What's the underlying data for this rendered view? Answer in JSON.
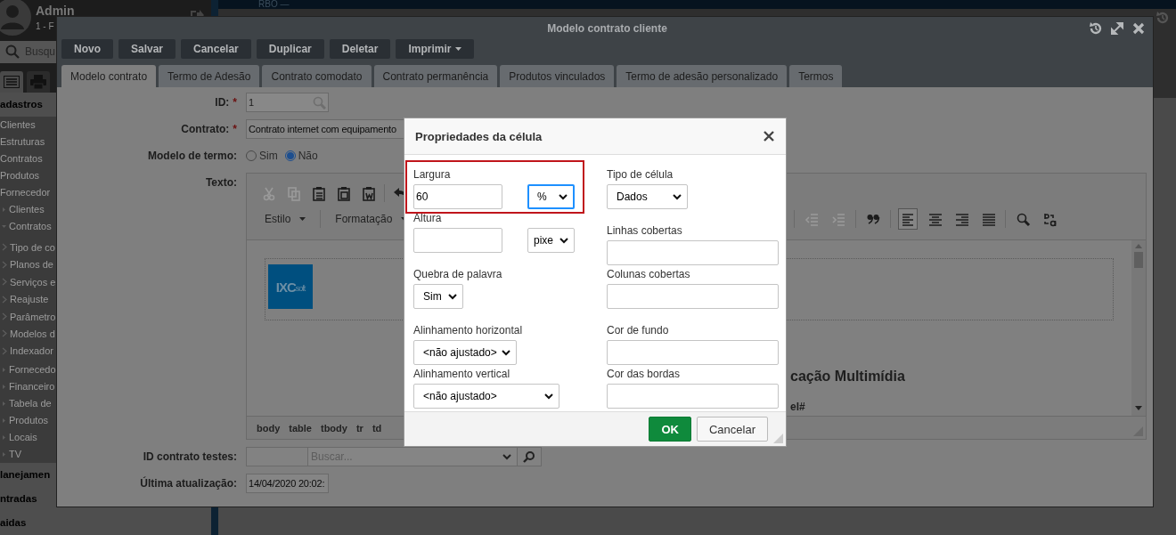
{
  "top_bar": {
    "title": "RBO —"
  },
  "sidebar": {
    "user": {
      "name": "Admin",
      "subtitle": "1 - F"
    },
    "search": {
      "placeholder": "Busqu"
    },
    "tabs": [
      {
        "kind": "list",
        "selected": true
      },
      {
        "kind": "printer",
        "selected": false
      }
    ],
    "sections": [
      {
        "label": "adastros",
        "items": [
          {
            "label": "Clientes",
            "kind": "link"
          },
          {
            "label": "Estruturas",
            "kind": "link"
          },
          {
            "label": "Contratos",
            "kind": "link"
          },
          {
            "label": "Produtos",
            "kind": "link"
          },
          {
            "label": "Fornecedor",
            "kind": "link"
          },
          {
            "label": "Clientes",
            "kind": "folder",
            "expanded": false
          },
          {
            "label": "Contratos",
            "kind": "folder",
            "expanded": true,
            "children": [
              {
                "label": "Tipo de co"
              },
              {
                "label": "Planos de"
              },
              {
                "label": "Serviços e"
              },
              {
                "label": "Reajuste"
              },
              {
                "label": "Parâmetro"
              },
              {
                "label": "Modelos d"
              },
              {
                "label": "Indexador"
              }
            ]
          },
          {
            "label": "Fornecedo",
            "kind": "folder",
            "expanded": false
          },
          {
            "label": "Financeiro",
            "kind": "folder",
            "expanded": false
          },
          {
            "label": "Tabela de",
            "kind": "folder",
            "expanded": false
          },
          {
            "label": "Produtos",
            "kind": "folder",
            "expanded": false
          },
          {
            "label": "Locais",
            "kind": "folder",
            "expanded": false
          },
          {
            "label": "TV",
            "kind": "folder",
            "expanded": false
          }
        ]
      },
      {
        "label": "lanejamen"
      },
      {
        "label": "ntradas"
      },
      {
        "label": "aidas"
      }
    ]
  },
  "window": {
    "title": "Modelo contrato cliente",
    "toolbar": [
      {
        "label": "Novo",
        "dropdown": false
      },
      {
        "label": "Salvar",
        "dropdown": false
      },
      {
        "label": "Cancelar",
        "dropdown": false
      },
      {
        "label": "Duplicar",
        "dropdown": false
      },
      {
        "label": "Deletar",
        "dropdown": false
      },
      {
        "label": "Imprimir",
        "dropdown": true
      }
    ],
    "tabs": [
      {
        "label": "Modelo contrato",
        "selected": true
      },
      {
        "label": "Termo de Adesão",
        "selected": false
      },
      {
        "label": "Contrato comodato",
        "selected": false
      },
      {
        "label": "Contrato permanência",
        "selected": false
      },
      {
        "label": "Produtos vinculados",
        "selected": false
      },
      {
        "label": "Termo de adesão personalizado",
        "selected": false
      },
      {
        "label": "Termos",
        "selected": false
      }
    ],
    "form": [
      {
        "kind": "lookup",
        "label": "ID:",
        "required_mark": "*",
        "value": "1",
        "disabled": true
      },
      {
        "kind": "text",
        "label": "Contrato:",
        "required_mark": "*",
        "value": "Contrato internet com equipamento"
      },
      {
        "kind": "radio",
        "label": "Modelo de termo:",
        "options": [
          {
            "label": "Sim",
            "selected": false
          },
          {
            "label": "Não",
            "selected": true
          }
        ]
      },
      {
        "kind": "editor",
        "label": "Texto:"
      },
      {
        "kind": "search_select",
        "label": "ID contrato testes:",
        "placeholder": "Buscar..."
      },
      {
        "kind": "text",
        "label": "Última atualização:",
        "value": "14/04/2020 20:02:"
      }
    ],
    "editor": {
      "row1_tools": [
        {
          "kind": "cut",
          "disabled": true
        },
        {
          "kind": "copy",
          "disabled": true
        },
        {
          "kind": "paste",
          "disabled": false
        },
        {
          "kind": "paste_text",
          "disabled": false
        },
        {
          "kind": "paste_word",
          "disabled": false
        },
        {
          "kind": "undo",
          "disabled": false
        }
      ],
      "menus": [
        {
          "label": "Estilo"
        },
        {
          "label": "Formatação"
        }
      ],
      "row2_tools": [
        {
          "kind": "outdent",
          "disabled": true,
          "selected": false
        },
        {
          "kind": "indent",
          "disabled": true,
          "selected": false
        },
        {
          "kind": "blockquote",
          "disabled": false,
          "selected": false
        },
        {
          "kind": "align_left",
          "disabled": false,
          "selected": true
        },
        {
          "kind": "align_center",
          "disabled": false,
          "selected": false
        },
        {
          "kind": "align_right",
          "disabled": false,
          "selected": false
        },
        {
          "kind": "justify",
          "disabled": false,
          "selected": false
        },
        {
          "kind": "find",
          "disabled": false,
          "selected": false
        },
        {
          "kind": "replace",
          "disabled": false,
          "selected": false
        }
      ],
      "content": {
        "logo": {
          "main": "IXC",
          "sub": "soft"
        },
        "heading": "cação Multimídia",
        "line": "el#"
      },
      "path": [
        "body",
        "table",
        "tbody",
        "tr",
        "td"
      ]
    }
  },
  "dialog": {
    "title": "Propriedades da célula",
    "left_fields": [
      {
        "kind": "size",
        "label": "Largura",
        "value": "60",
        "unit": "%",
        "unit_focused": true,
        "highlighted": true
      },
      {
        "kind": "size",
        "label": "Altura",
        "unit": "pixe",
        "unit_focused": false,
        "highlighted": false
      },
      {
        "kind": "select",
        "label": "Quebra de palavra",
        "value": "Sim"
      },
      {
        "kind": "select",
        "label": "Alinhamento horizontal",
        "value": "<não ajustado>"
      },
      {
        "kind": "select",
        "label": "Alinhamento vertical",
        "value": "<não ajustado>"
      }
    ],
    "right_fields": [
      {
        "kind": "select",
        "label": "Tipo de célula",
        "value": "Dados"
      },
      {
        "kind": "text",
        "label": "Linhas cobertas"
      },
      {
        "kind": "text",
        "label": "Colunas cobertas"
      },
      {
        "kind": "text",
        "label": "Cor de fundo"
      },
      {
        "kind": "text",
        "label": "Cor das bordas"
      }
    ],
    "buttons": [
      {
        "label": "OK",
        "kind": "primary"
      },
      {
        "label": "Cancelar",
        "kind": "secondary"
      }
    ]
  }
}
